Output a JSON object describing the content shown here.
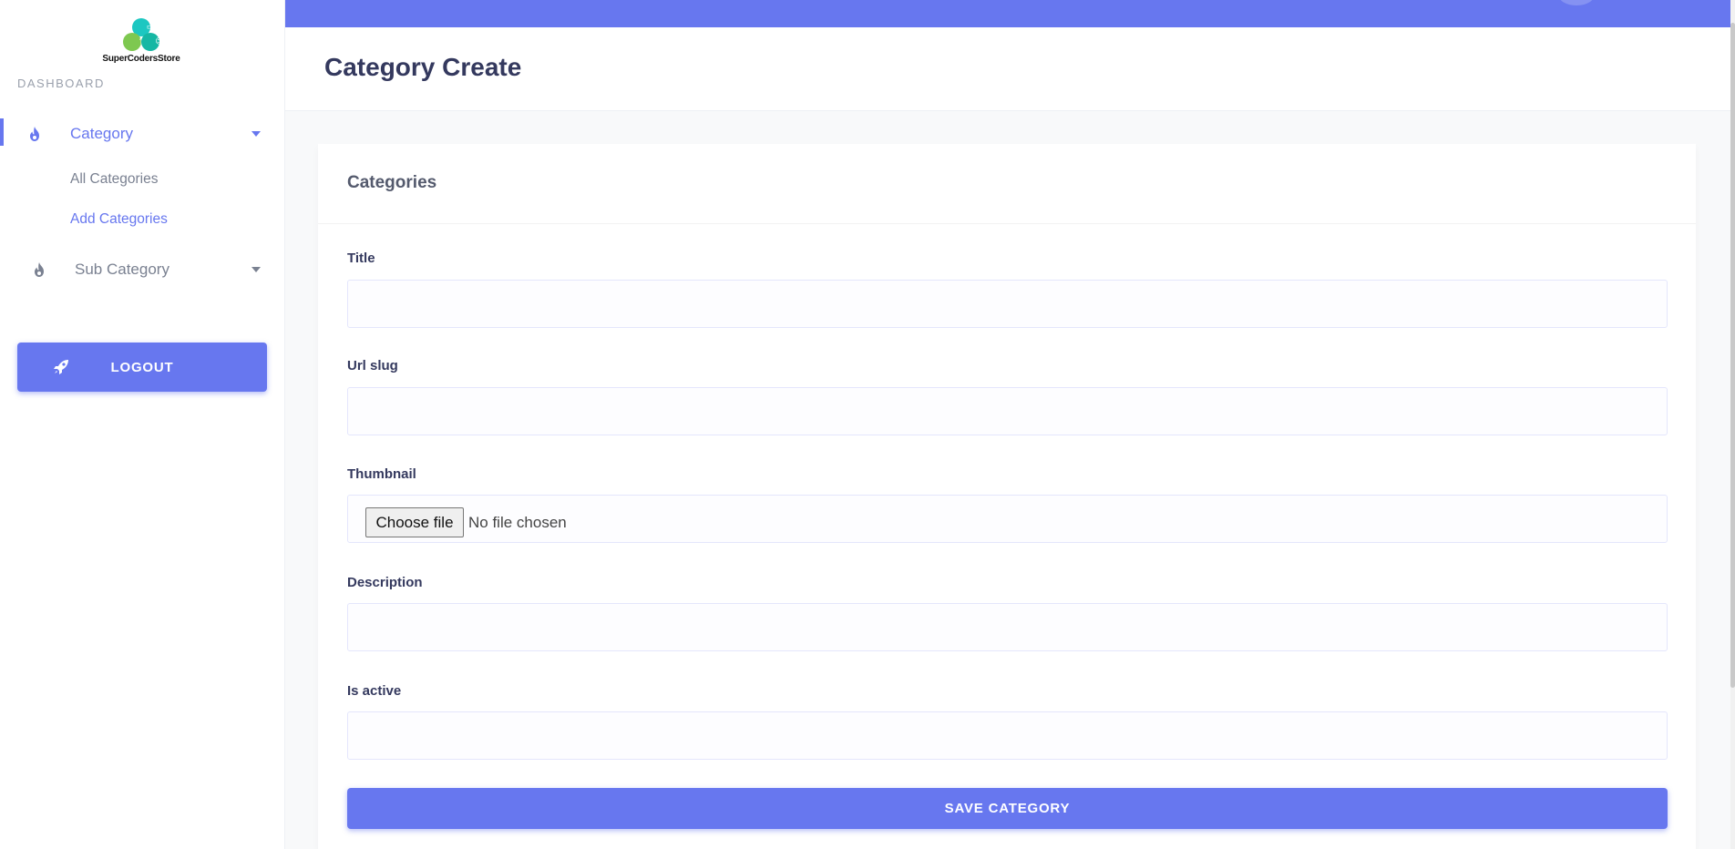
{
  "brand": {
    "name": "SuperCodersStore",
    "logo_icon": "store-logo-icon"
  },
  "sidebar": {
    "section_label": "DASHBOARD",
    "menus": [
      {
        "label": "Category",
        "icon": "fire-icon",
        "expanded": true,
        "items": [
          {
            "label": "All Categories",
            "active": false
          },
          {
            "label": "Add Categories",
            "active": true
          }
        ]
      },
      {
        "label": "Sub Category",
        "icon": "fire-icon",
        "expanded": false
      }
    ],
    "logout_label": "LOGOUT",
    "logout_icon": "rocket-icon"
  },
  "page": {
    "title": "Category Create"
  },
  "form": {
    "card_title": "Categories",
    "fields": {
      "title": {
        "label": "Title",
        "value": ""
      },
      "url_slug": {
        "label": "Url slug",
        "value": ""
      },
      "thumbnail": {
        "label": "Thumbnail",
        "button_label": "Choose file",
        "status": "No file chosen"
      },
      "description": {
        "label": "Description",
        "value": ""
      },
      "is_active": {
        "label": "Is active",
        "value": ""
      }
    },
    "submit_label": "SAVE CATEGORY"
  },
  "colors": {
    "primary": "#6777ef",
    "sidebar_text": "#7a8191",
    "heading": "#34395e",
    "background": "#f8f9fa"
  }
}
